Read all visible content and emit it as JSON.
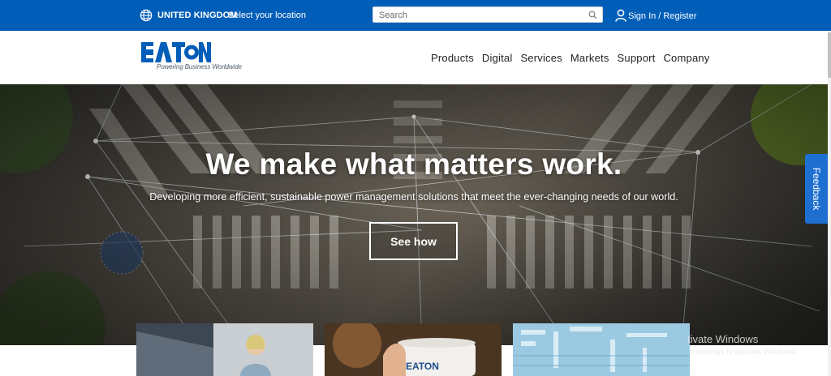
{
  "topbar": {
    "country": "UNITED KINGDOM",
    "select_location": "Select your location",
    "search_placeholder": "Search",
    "signin": "Sign In / Register"
  },
  "header": {
    "logo_text": "EATON",
    "tagline": "Powering Business Worldwide",
    "nav": [
      "Products",
      "Digital",
      "Services",
      "Markets",
      "Support",
      "Company"
    ]
  },
  "hero": {
    "title": "We make what matters work.",
    "subtitle": "Developing more efficient, sustainable power management solutions that meet the ever-changing needs of our world.",
    "cta": "See how"
  },
  "card_logo_text": "EATON",
  "feedback_label": "Feedback",
  "watermark": {
    "line1": "tivate Windows",
    "line2": "o Settings to activate Windows."
  },
  "colors": {
    "brand_blue": "#005eb8",
    "feedback_blue": "#1f6fd1"
  },
  "icons": [
    "globe-icon",
    "search-icon",
    "user-icon"
  ]
}
